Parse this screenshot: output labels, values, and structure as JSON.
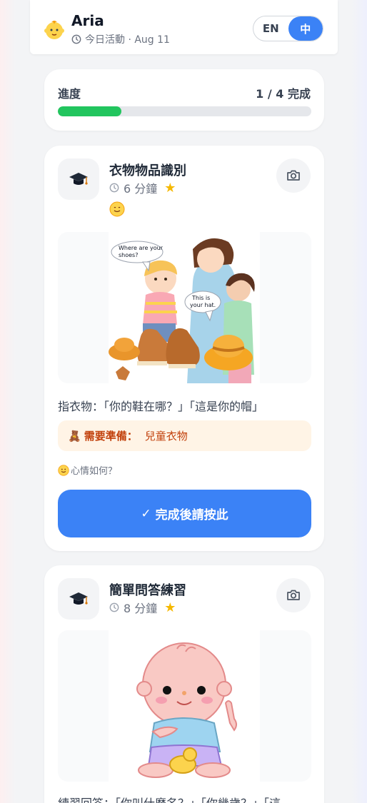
{
  "header": {
    "child_name": "Aria",
    "subtitle": "今日活動 · Aug 11",
    "languages": [
      "EN",
      "中"
    ],
    "active_language": "中"
  },
  "progress": {
    "label": "進度",
    "count_text": "1 / 4 完成",
    "completed": 1,
    "total": 4,
    "fill_color": "#22c55e"
  },
  "activities": [
    {
      "title": "衣物物品識別",
      "duration": "6 分鐘",
      "icon": "graduation-cap-icon",
      "illustration_bubbles": [
        "Where are your",
        "shoes?",
        "This is",
        "your hat."
      ],
      "instruction": "指衣物：「你的鞋在哪？」「這是你的帽」",
      "prep_label": "需要準備：",
      "prep_value": "兒童衣物",
      "mood_question": "心情如何？",
      "done_button": "完成後請按此"
    },
    {
      "title": "簡單問答練習",
      "duration": "8 分鐘",
      "icon": "graduation-cap-icon",
      "instruction": "練習回答：「你叫什麼名？」「你幾歲？」「這"
    }
  ],
  "colors": {
    "accent": "#3b82f6",
    "progress": "#22c55e",
    "prep_text": "#c2410c",
    "star": "#f5b800"
  }
}
